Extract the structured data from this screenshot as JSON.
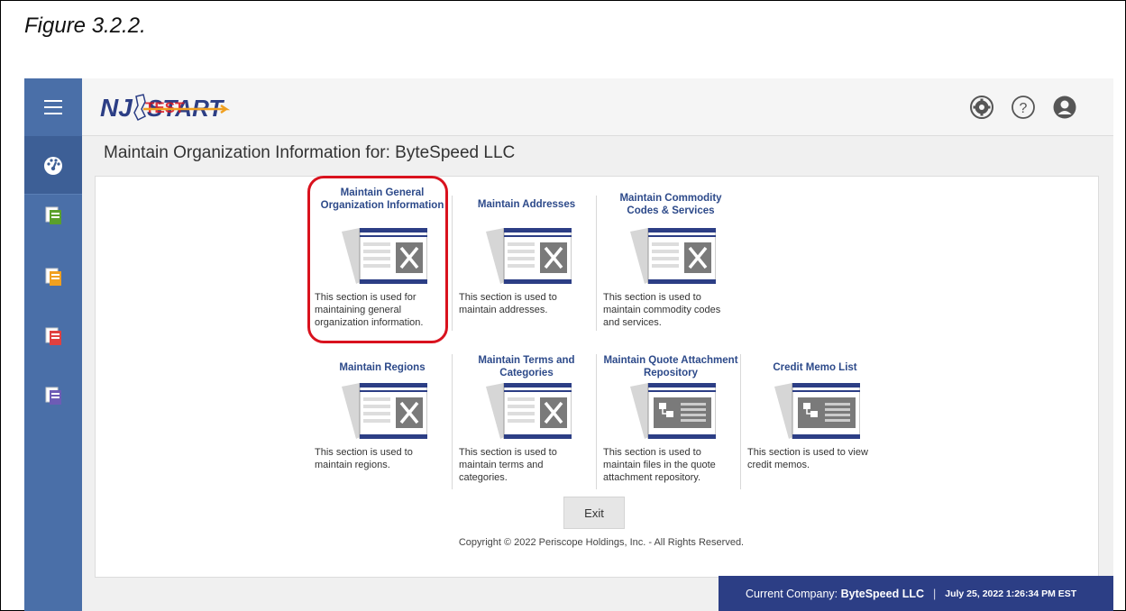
{
  "figure_caption": "Figure 3.2.2.",
  "header": {
    "logo_text": "NJSTART",
    "logo_overlay": "TEST"
  },
  "page_title": "Maintain Organization Information for: ByteSpeed LLC",
  "tiles": [
    {
      "title": "Maintain General Organization Information",
      "desc": "This section is used for maintaining general organization information.",
      "icon": "config-tools-icon",
      "highlighted": true
    },
    {
      "title": "Maintain Addresses",
      "desc": "This section is used to maintain addresses.",
      "icon": "config-tools-icon"
    },
    {
      "title": "Maintain Commodity Codes & Services",
      "desc": "This section is used to maintain commodity codes and services.",
      "icon": "config-tools-icon"
    },
    {
      "title": "Maintain Regions",
      "desc": "This section is used to maintain regions.",
      "icon": "config-tools-icon"
    },
    {
      "title": "Maintain Terms and Categories",
      "desc": "This section is used to maintain terms and categories.",
      "icon": "config-tools-icon"
    },
    {
      "title": "Maintain Quote Attachment Repository",
      "desc": "This section is used to maintain files in the quote attachment repository.",
      "icon": "list-document-icon"
    },
    {
      "title": "Credit Memo List",
      "desc": "This section is used to view credit memos.",
      "icon": "list-document-icon"
    }
  ],
  "exit_label": "Exit",
  "copyright": "Copyright © 2022 Periscope Holdings, Inc. - All Rights Reserved.",
  "status_bar": {
    "company_prefix": "Current Company:",
    "company_name": "ByteSpeed LLC",
    "separator": "|",
    "datetime": "July 25, 2022 1:26:34 PM EST"
  },
  "colors": {
    "sidebar": "#4a6fa8",
    "title_blue": "#2d4a8a",
    "status_bar": "#2c3e85",
    "highlight": "#d9121e"
  }
}
